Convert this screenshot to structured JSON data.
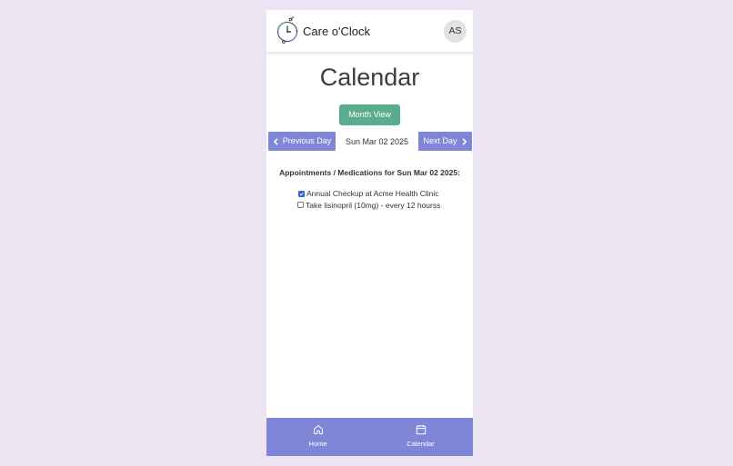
{
  "header": {
    "app_title": "Care o'Clock",
    "avatar_initials": "AS",
    "logo_icon": "clock-logo-icon"
  },
  "main": {
    "page_title": "Calendar",
    "month_view_label": "Month View",
    "prev_day_label": "Previous Day",
    "next_day_label": "Next Day",
    "current_date": "Sun Mar 02 2025",
    "list_heading": "Appointments / Medications for Sun Mar 02 2025:",
    "items": [
      {
        "label": "Annual Checkup at Acme Health Clinic",
        "checked": true
      },
      {
        "label": "Take lisinopril (10mg) - every 12 hourss",
        "checked": false
      }
    ]
  },
  "bottom_nav": {
    "tabs": [
      {
        "label": "Home",
        "icon": "home-icon"
      },
      {
        "label": "Calendar",
        "icon": "calendar-icon"
      }
    ]
  },
  "colors": {
    "background": "#ebe4f2",
    "accent": "#7f86d8",
    "month_view_button": "#5aad8c",
    "checkbox_checked": "#2f65d9"
  }
}
